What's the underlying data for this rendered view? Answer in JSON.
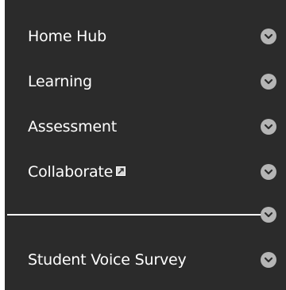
{
  "nav": {
    "items": [
      {
        "label": "Home Hub"
      },
      {
        "label": "Learning"
      },
      {
        "label": "Assessment"
      },
      {
        "label": "Collaborate",
        "icon": "external-link-icon"
      },
      {
        "label": "Student Voice Survey"
      }
    ]
  },
  "colors": {
    "panel_background": "#2b2b2b",
    "text": "#ffffff",
    "chevron_circle": "#b5b5b5",
    "chevron_arrow": "#2b2b2b",
    "divider": "#ffffff"
  },
  "icons": {
    "expand": "chevron-down-icon",
    "collaborate": "external-link-icon"
  }
}
